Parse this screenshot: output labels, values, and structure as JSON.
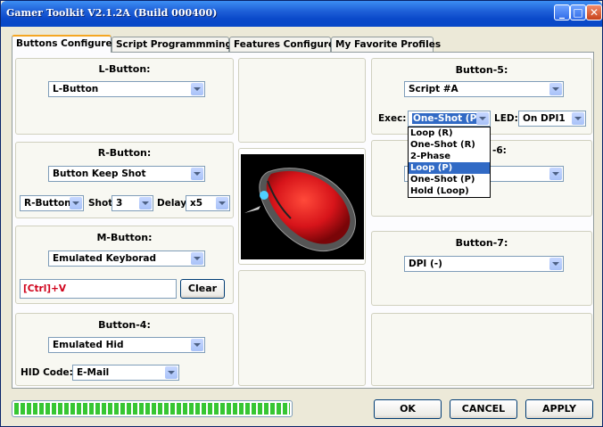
{
  "window": {
    "title": "Gamer Toolkit V2.1.2A (Build 000400)",
    "min_glyph": "_",
    "max_glyph": "□",
    "close_glyph": "✕"
  },
  "tabs": [
    {
      "label": "Buttons Configure",
      "active": true
    },
    {
      "label": "Script Programmming",
      "active": false
    },
    {
      "label": "Features Configure",
      "active": false
    },
    {
      "label": "My Favorite Profiles",
      "active": false
    }
  ],
  "l_button": {
    "title": "L-Button:",
    "value": "L-Button"
  },
  "r_button": {
    "title": "R-Button:",
    "value": "Button Keep Shot",
    "key": "R-Button",
    "shot_label": "Shot",
    "shot_value": "3",
    "delay_label": "Delay",
    "delay_value": "x5"
  },
  "m_button": {
    "title": "M-Button:",
    "value": "Emulated Keyborad",
    "keys": "[Ctrl]+V",
    "clear_label": "Clear"
  },
  "button4": {
    "title": "Button-4:",
    "value": "Emulated Hid",
    "hid_label": "HID Code:",
    "hid_value": "E-Mail"
  },
  "button5": {
    "title": "Button-5:",
    "value": "Script #A",
    "exec_label": "Exec:",
    "exec_value": "One-Shot (P)",
    "led_label": "LED:",
    "led_value": "On DPI1",
    "exec_options": [
      "Loop (R)",
      "One-Shot (R)",
      "2-Phase",
      "Loop (P)",
      "One-Shot (P)",
      "Hold (Loop)"
    ],
    "highlighted_option": "Loop (P)"
  },
  "button6": {
    "title_visible": "-6:"
  },
  "button7": {
    "title": "Button-7:",
    "value": "DPI (-)"
  },
  "footer": {
    "progress": 1.0,
    "ok_label": "OK",
    "cancel_label": "CANCEL",
    "apply_label": "APPLY"
  },
  "colors": {
    "titlebar": "#0a49c9",
    "active_tab_accent": "#f5a623",
    "progress_green": "#37c632",
    "selection_blue": "#316ac5",
    "key_text_red": "#d0021b"
  }
}
